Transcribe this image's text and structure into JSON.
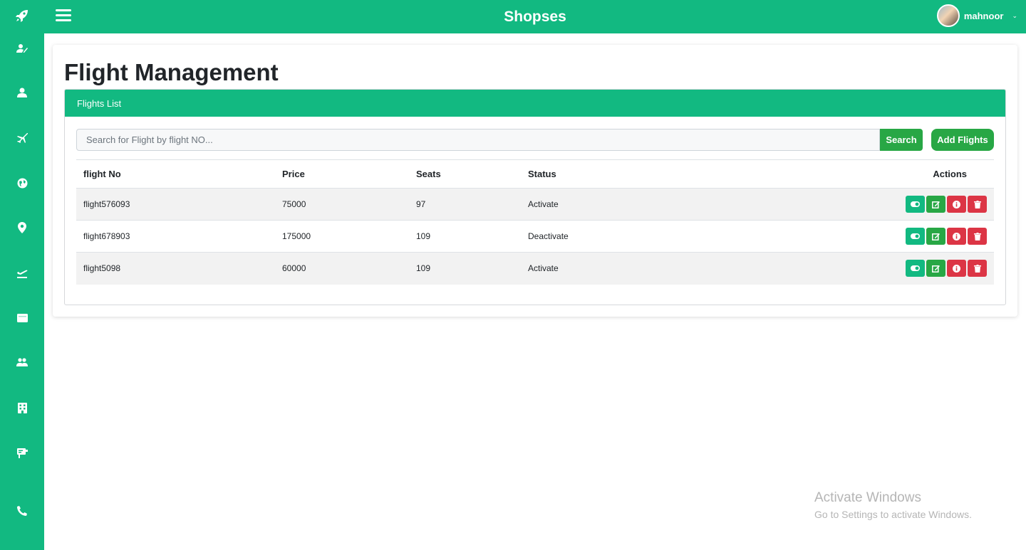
{
  "app": {
    "brand": "Shopses",
    "username": "mahnoor",
    "caret": "⌄"
  },
  "sidebar": {
    "items": [
      {
        "icon": "rocket-icon"
      },
      {
        "icon": "user-edit-icon"
      },
      {
        "icon": "user-icon"
      },
      {
        "icon": "plane-icon"
      },
      {
        "icon": "globe-icon"
      },
      {
        "icon": "map-marker-icon"
      },
      {
        "icon": "plane-departure-icon"
      },
      {
        "icon": "ticket-icon"
      },
      {
        "icon": "users-icon"
      },
      {
        "icon": "building-icon"
      },
      {
        "icon": "sign-icon"
      },
      {
        "icon": "phone-icon"
      }
    ]
  },
  "page": {
    "title": "Flight Management"
  },
  "panel": {
    "header": "Flights List"
  },
  "search": {
    "placeholder": "Search for Flight by flight NO...",
    "value": "",
    "button": "Search"
  },
  "add_button": "Add Flights",
  "table": {
    "headers": {
      "flight_no": "flight No",
      "price": "Price",
      "seats": "Seats",
      "status": "Status",
      "actions": "Actions"
    },
    "rows": [
      {
        "flight_no": "flight576093",
        "price": "75000",
        "seats": "97",
        "status": "Activate"
      },
      {
        "flight_no": "flight678903",
        "price": "175000",
        "seats": "109",
        "status": "Deactivate"
      },
      {
        "flight_no": "flight5098",
        "price": "60000",
        "seats": "109",
        "status": "Activate"
      }
    ],
    "action_icons": [
      "toggle-icon",
      "edit-icon",
      "info-icon",
      "trash-icon"
    ]
  },
  "watermark": {
    "title": "Activate Windows",
    "subtitle": "Go to Settings to activate Windows."
  },
  "colors": {
    "primary": "#12b981",
    "success": "#28a745",
    "danger": "#dc3545"
  }
}
